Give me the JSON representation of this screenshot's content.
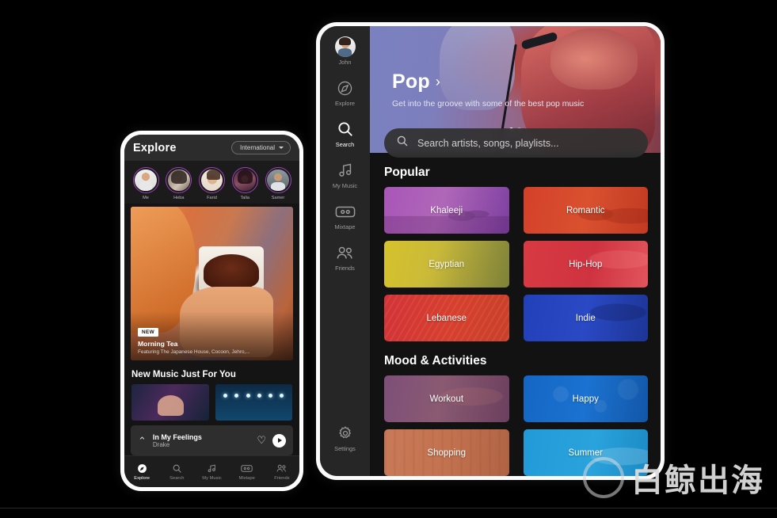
{
  "phone": {
    "header": {
      "title": "Explore",
      "region_filter": "International",
      "chevron_icon": "chevron-down-icon"
    },
    "stories": [
      {
        "name": "Me"
      },
      {
        "name": "Heba"
      },
      {
        "name": "Farid"
      },
      {
        "name": "Talia"
      },
      {
        "name": "Samer"
      }
    ],
    "featured": {
      "badge": "NEW",
      "title": "Morning Tea",
      "subtitle": "Featuring The Japanese House, Cocoon, Jehro,..."
    },
    "section_title": "New Music Just For You",
    "now_playing": {
      "expand_icon": "chevron-up-icon",
      "title": "In My Feelings",
      "artist": "Drake",
      "like_icon": "heart-icon",
      "play_icon": "play-icon"
    },
    "tabs": [
      {
        "label": "Explore",
        "icon": "compass-icon",
        "active": true
      },
      {
        "label": "Search",
        "icon": "search-icon",
        "active": false
      },
      {
        "label": "My Music",
        "icon": "music-note-icon",
        "active": false
      },
      {
        "label": "Mixtape",
        "icon": "cassette-icon",
        "active": false
      },
      {
        "label": "Friends",
        "icon": "people-icon",
        "active": false
      }
    ]
  },
  "tablet": {
    "sidebar": {
      "profile": {
        "name": "John",
        "icon": "avatar"
      },
      "items": [
        {
          "label": "Explore",
          "icon": "compass-icon",
          "active": false
        },
        {
          "label": "Search",
          "icon": "search-icon",
          "active": true
        },
        {
          "label": "My Music",
          "icon": "music-note-icon",
          "active": false
        },
        {
          "label": "Mixtape",
          "icon": "cassette-icon",
          "active": false
        },
        {
          "label": "Friends",
          "icon": "people-icon",
          "active": false
        }
      ],
      "settings": {
        "label": "Settings",
        "icon": "gear-icon"
      }
    },
    "hero": {
      "title": "Pop",
      "arrow": "›",
      "description": "Get into the groove with some of the best pop music",
      "carousel_dots": 2,
      "active_dot": 1
    },
    "search": {
      "placeholder": "Search artists, songs, playlists...",
      "icon": "search-icon"
    },
    "sections": [
      {
        "title": "Popular",
        "tiles": [
          {
            "label": "Khaleeji",
            "color": "#a855b8"
          },
          {
            "label": "Romantic",
            "color": "#d4402a"
          },
          {
            "label": "Egyptian",
            "color": "#d6c22c"
          },
          {
            "label": "Hip-Hop",
            "color": "#d83a42"
          },
          {
            "label": "Lebanese",
            "color": "#d23338"
          },
          {
            "label": "Indie",
            "color": "#2240b8"
          }
        ]
      },
      {
        "title": "Mood & Activities",
        "tiles": [
          {
            "label": "Workout",
            "color": "#7d4f78"
          },
          {
            "label": "Happy",
            "color": "#1566c4"
          },
          {
            "label": "Shopping",
            "color": "#c97a58"
          },
          {
            "label": "Summer",
            "color": "#219ad8"
          }
        ]
      }
    ]
  },
  "watermark": {
    "text": "白鲸出海",
    "logo_icon": "circle-logo-icon"
  }
}
